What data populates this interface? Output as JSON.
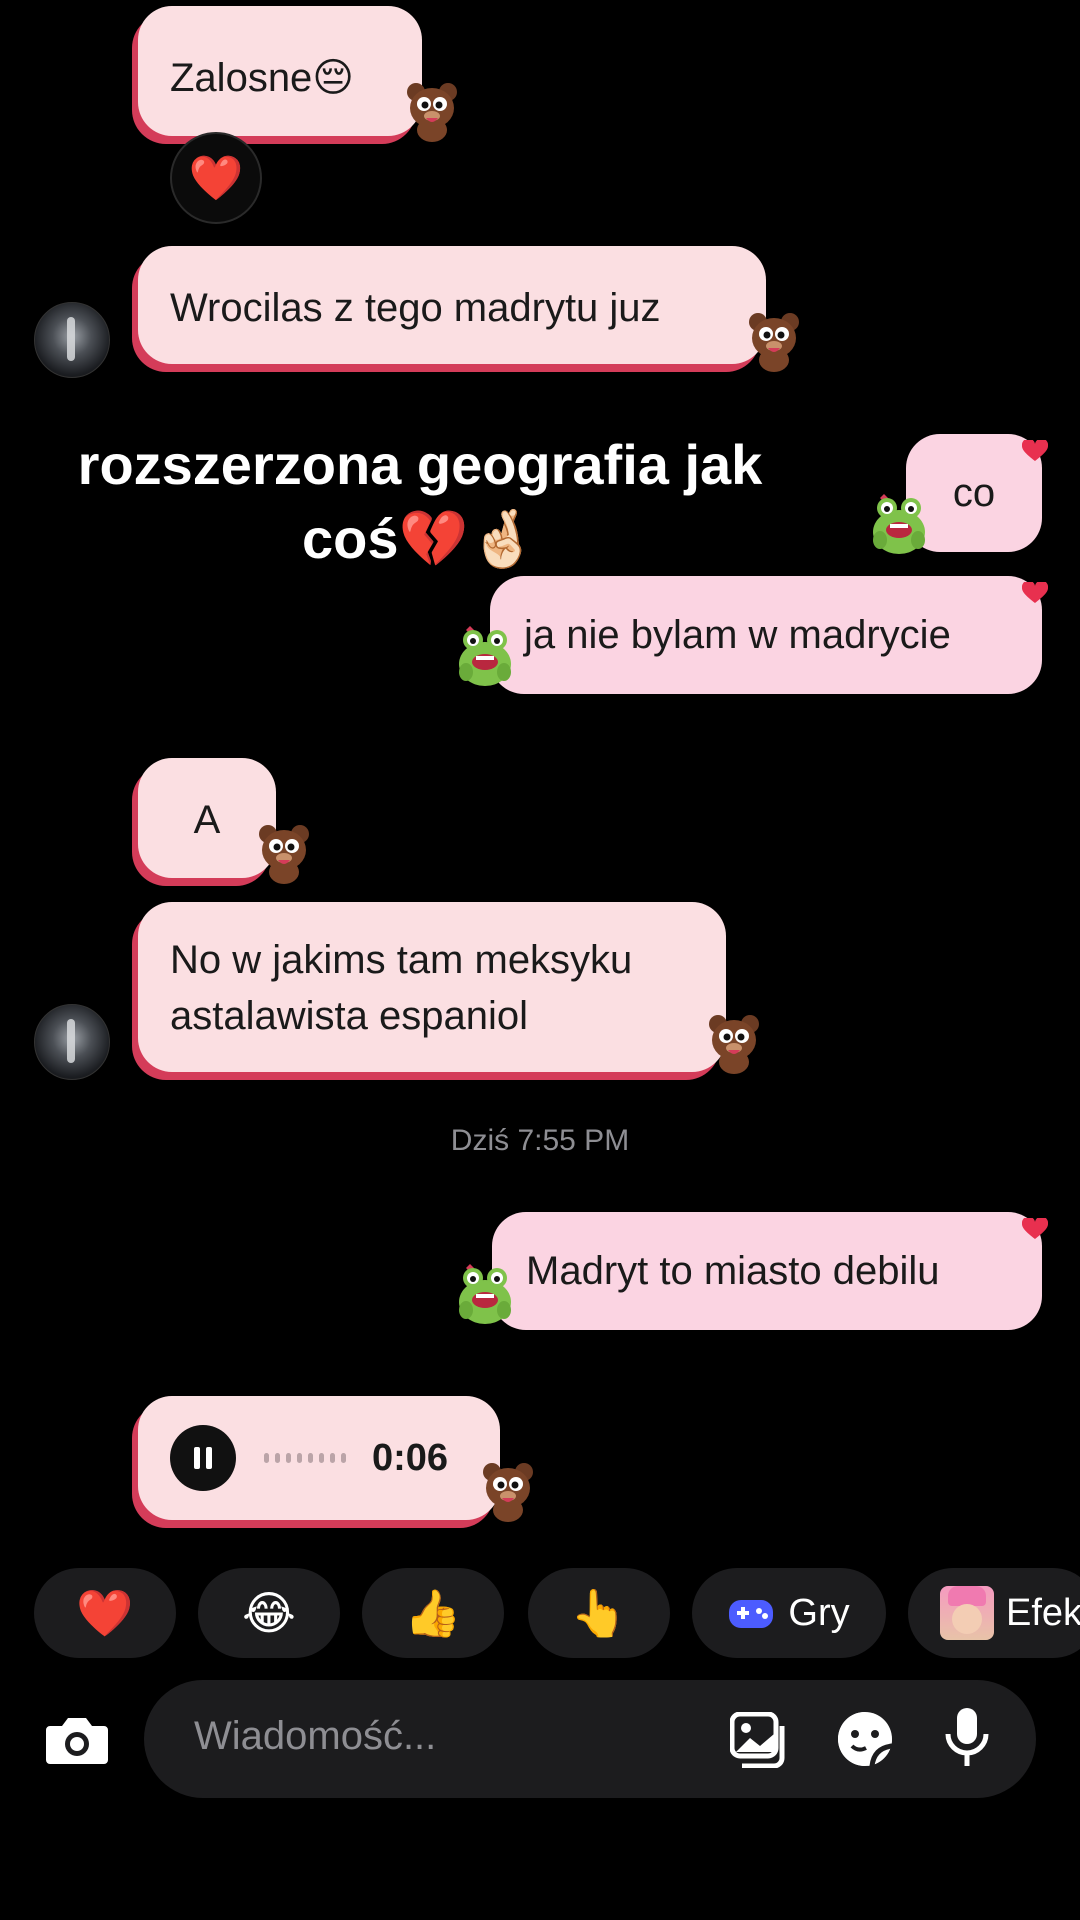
{
  "messages": [
    {
      "id": "m1",
      "side": "in",
      "text": "Zalosne😔"
    },
    {
      "id": "m2",
      "side": "in",
      "text": "Wrocilas z tego madrytu juz"
    },
    {
      "id": "m3",
      "side": "out",
      "text": "co"
    },
    {
      "id": "m4",
      "side": "out",
      "text": "ja nie bylam w madrycie"
    },
    {
      "id": "m5",
      "side": "in",
      "text": "A"
    },
    {
      "id": "m6",
      "side": "in",
      "line1": "No w jakims tam meksyku",
      "line2": "astalawista espaniol"
    },
    {
      "id": "m7",
      "side": "out",
      "text": "Madryt to miasto debilu"
    }
  ],
  "reaction_emoji": "❤️",
  "overlay_caption": {
    "line1": "rozszerzona geografia jak",
    "line2": "coś💔🤞🏻"
  },
  "timestamp": "Dziś 7:55 PM",
  "voice_message": {
    "duration": "0:06"
  },
  "quick_reactions": [
    {
      "id": "heart",
      "emoji": "❤️"
    },
    {
      "id": "laugh",
      "emoji": "😂"
    },
    {
      "id": "thumbs",
      "emoji": "👍"
    },
    {
      "id": "point",
      "emoji": "👆"
    },
    {
      "id": "games",
      "label": "Gry"
    },
    {
      "id": "effects",
      "label": "Efek"
    }
  ],
  "composer": {
    "placeholder": "Wiadomość..."
  },
  "colors": {
    "incoming": "#fbdfe2",
    "outgoing": "#fbd4e2",
    "accent_shadow": "#d43c59",
    "background": "#000000"
  }
}
